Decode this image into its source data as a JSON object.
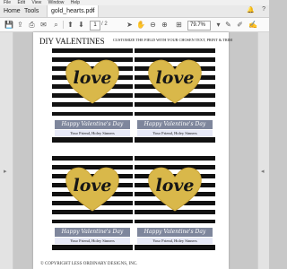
{
  "menu": {
    "items": [
      "File",
      "Edit",
      "View",
      "Window",
      "Help"
    ]
  },
  "tabs": {
    "home": "Home",
    "tools": "Tools",
    "document": "gold_hearts.pdf",
    "close_glyph": "×"
  },
  "toolbar": {
    "page_number": "1",
    "page_count": "/ 2",
    "zoom": "79.7%"
  },
  "page": {
    "title": "DIY VALENTINES",
    "subtitle": "CUSTOMIZE THE FIELD WITH YOUR CHOSEN TEXT, PRINT & TRIM",
    "copyright": "© COPYRIGHT LESS ORDINARY DESIGNS, INC."
  },
  "cards": [
    {
      "heart_text": "love",
      "banner": "Happy Valentine's Day",
      "from": "Your Friend, Holey Sinners"
    },
    {
      "heart_text": "love",
      "banner": "Happy Valentine's Day",
      "from": "Your Friend, Holey Sinners"
    },
    {
      "heart_text": "love",
      "banner": "Happy Valentine's Day",
      "from": "Your Friend, Holey Sinners"
    },
    {
      "heart_text": "love",
      "banner": "Happy Valentine's Day",
      "from": "Your Friend, Holey Sinners"
    }
  ],
  "colors": {
    "gold": "#d9b84a",
    "banner": "#7e869c",
    "name_bar": "#e7e9f7",
    "stripe": "#111111"
  }
}
